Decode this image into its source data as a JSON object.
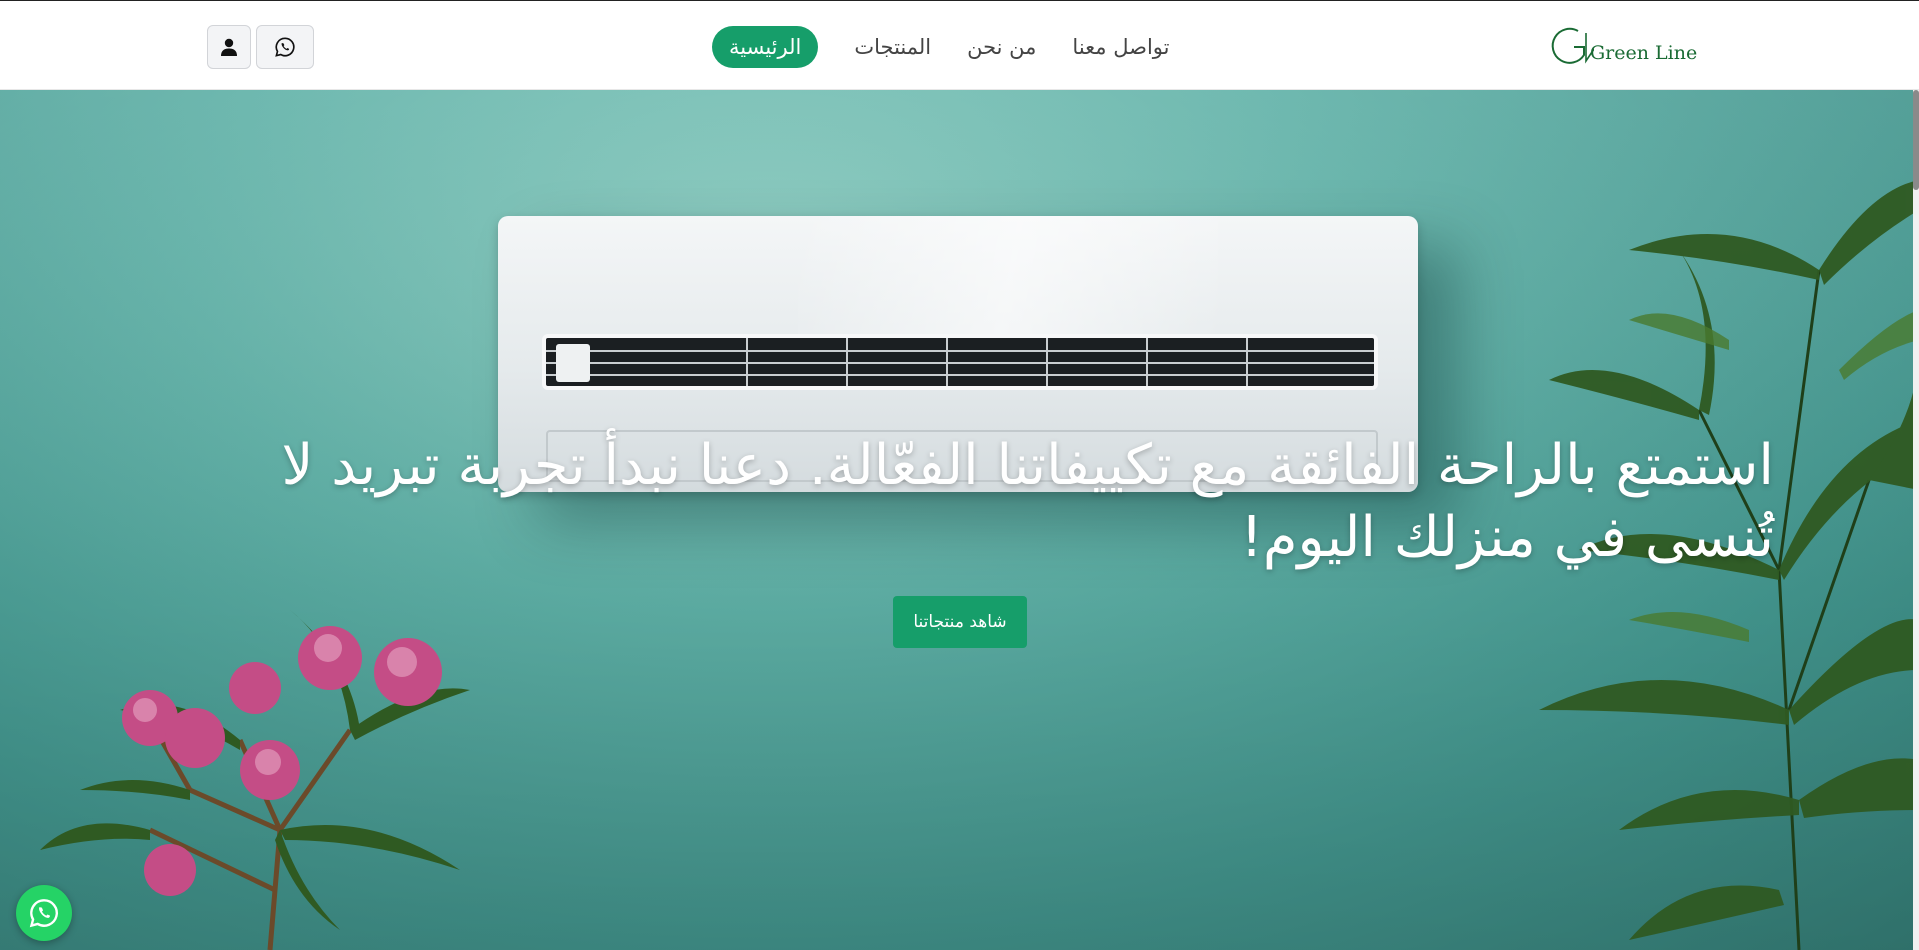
{
  "brand": {
    "logo_text": "Green Line",
    "logo_color": "#1a6b34"
  },
  "nav": {
    "items": [
      {
        "label": "الرئيسية",
        "active": true
      },
      {
        "label": "المنتجات",
        "active": false
      },
      {
        "label": "من نحن",
        "active": false
      },
      {
        "label": "تواصل معنا",
        "active": false
      }
    ]
  },
  "header_actions": {
    "user_icon": "user-icon",
    "whatsapp_icon": "whatsapp-icon"
  },
  "hero": {
    "headline": "استمتع بالراحة الفائقة مع تكييفاتنا الفعّالة. دعنا نبدأ تجربة تبريد لا تُنسى في منزلك اليوم!",
    "cta_label": "شاهد منتجاتنا"
  },
  "floating": {
    "whatsapp_icon": "whatsapp-icon"
  },
  "colors": {
    "accent": "#169e6a",
    "whatsapp": "#25d366",
    "hero_bg": "#5fb1a7"
  }
}
